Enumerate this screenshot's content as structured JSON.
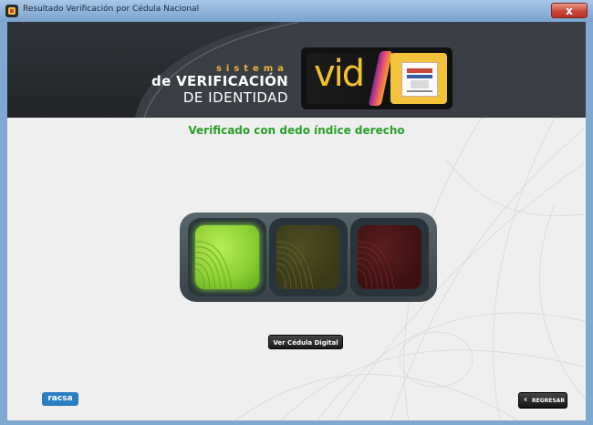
{
  "window": {
    "title": "Resultado Verificación por Cédula Nacional",
    "close_label": "x"
  },
  "header": {
    "brand_small": "sistema",
    "brand_line1": "de VERIFICACIÓN",
    "brand_line2": "DE IDENTIDAD",
    "logo_text": "vid"
  },
  "status": {
    "message": "Verificado con dedo índice derecho",
    "color": "#2aa02a"
  },
  "indicators": {
    "colors": {
      "success": "#8fd034",
      "warning": "#3a3a1a",
      "error": "#3f1212"
    },
    "active": "success"
  },
  "buttons": {
    "ver_cedula": "Ver Cédula Digital",
    "regresar": "REGRESAR"
  },
  "footer": {
    "racsa_label": "racsa"
  }
}
